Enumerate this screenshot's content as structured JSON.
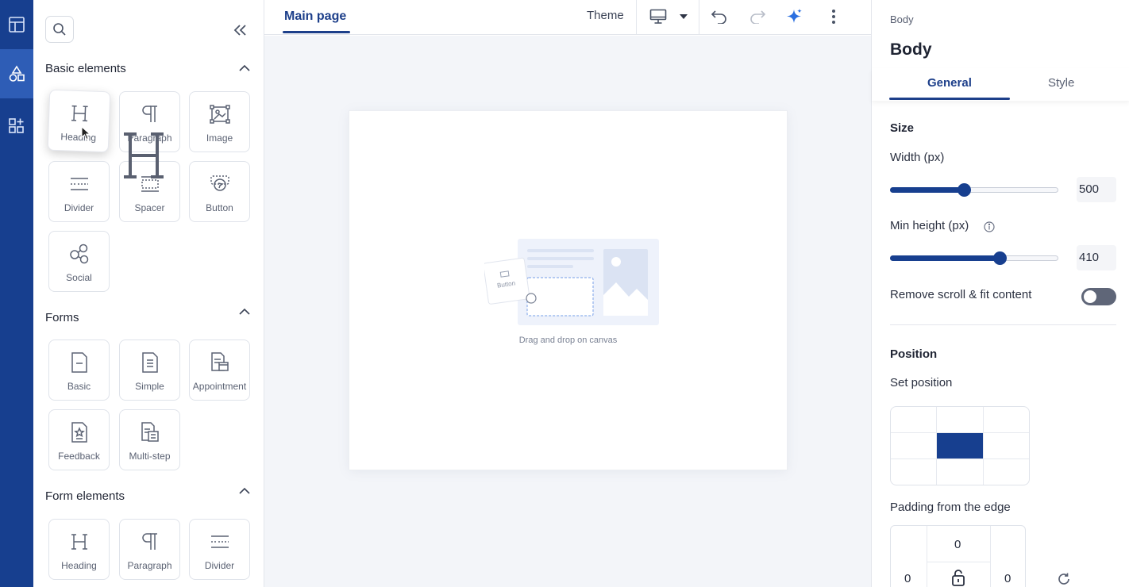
{
  "panel": {
    "sections": [
      {
        "title": "Basic elements",
        "items": [
          "Heading",
          "Paragraph",
          "Image",
          "Divider",
          "Spacer",
          "Button",
          "Social"
        ]
      },
      {
        "title": "Forms",
        "items": [
          "Basic",
          "Simple",
          "Appointment",
          "Feedback",
          "Multi-step"
        ]
      },
      {
        "title": "Form elements",
        "items": [
          "Heading",
          "Paragraph",
          "Divider"
        ]
      }
    ]
  },
  "topbar": {
    "tab_main": "Main page",
    "theme_label": "Theme"
  },
  "canvas": {
    "empty_hint": "Drag and drop on canvas",
    "illus_button_label": "Button"
  },
  "right": {
    "breadcrumb": "Body",
    "title": "Body",
    "tabs": [
      "General",
      "Style"
    ],
    "size_heading": "Size",
    "width_label": "Width (px)",
    "width_value": "500",
    "width_fraction": 0.44,
    "minheight_label": "Min height (px)",
    "minheight_value": "410",
    "minheight_fraction": 0.65,
    "remove_scroll_label": "Remove scroll & fit content",
    "remove_scroll_on": false,
    "position_heading": "Position",
    "set_position_label": "Set position",
    "selected_position": "center",
    "padding_label": "Padding from the edge",
    "padding_top": "0",
    "padding_left": "0",
    "padding_right": "0"
  },
  "colors": {
    "rail": "#173f8f",
    "accent": "#1d3f8a",
    "canvas_bg": "#f3f5f9"
  }
}
